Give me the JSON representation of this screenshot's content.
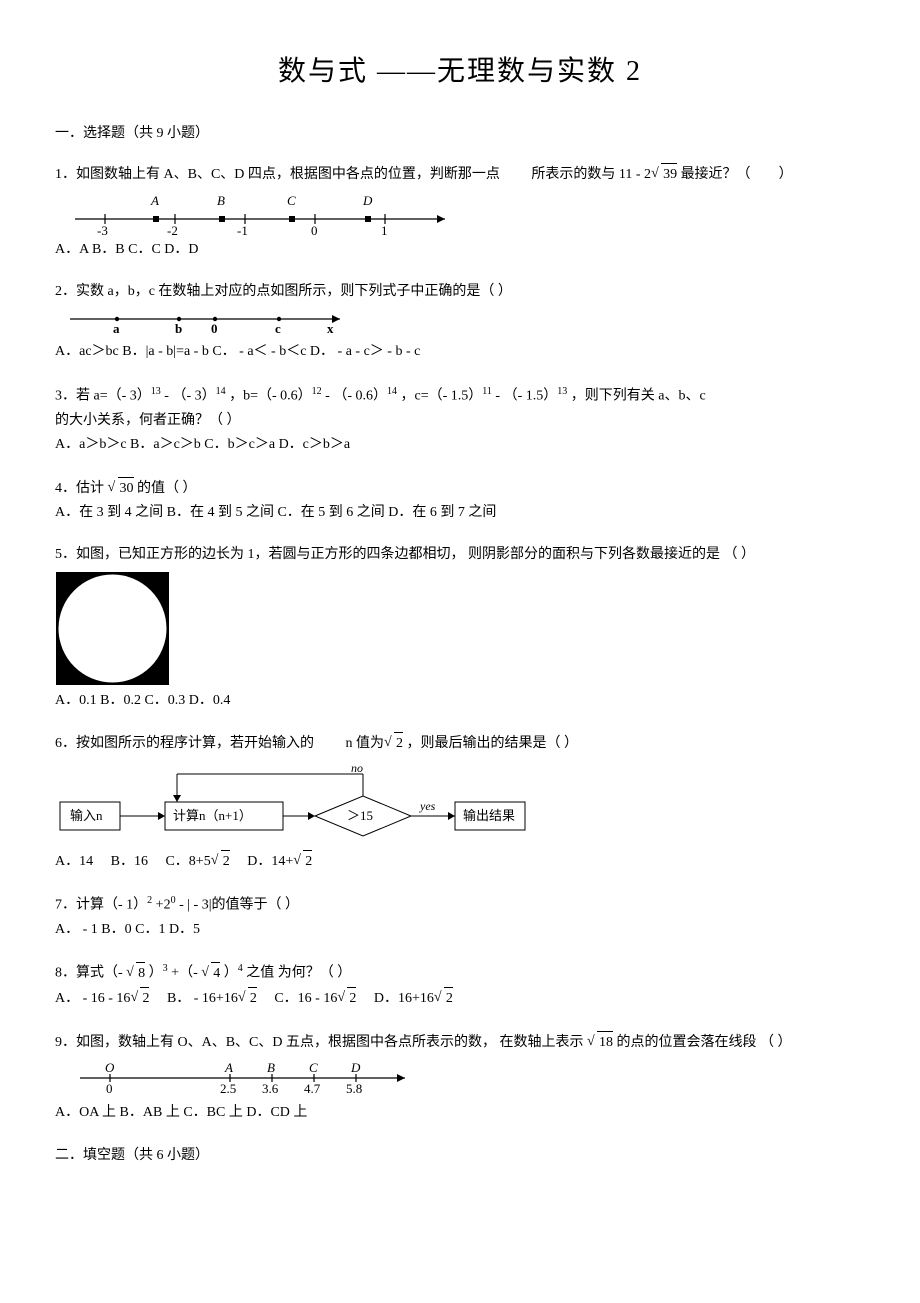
{
  "title": "数与式 ——无理数与实数  2",
  "section1": "一．选择题（共  9 小题）",
  "q1": {
    "stem_a": "1．如图数轴上有  A、B、C、D 四点，根据图中各点的位置，判断那一点",
    "stem_b": "所表示的数与  11 - 2",
    "stem_c": "最接近？（",
    "stem_d": "）",
    "sqrt": "39",
    "opt": "A．A    B．B    C．C    D．D"
  },
  "q2": {
    "stem": "2．实数  a，b，c 在数轴上对应的点如图所示，则下列式子中正确的是（            ）",
    "opt": "A．ac＞bc    B．|a - b|=a - b    C． - a＜ - b＜c   D． - a - c＞ - b - c"
  },
  "q3": {
    "stem_a": "3．若  a=（- 3）",
    "stem_b": " - （- 3）",
    "stem_c": "，b=（- 0.6）",
    "stem_d": " - （- 0.6）",
    "stem_e": "，c=（- 1.5）",
    "stem_f": " - （- 1.5）",
    "stem_g": "，则下列有关   a、b、c",
    "e1": "13",
    "e2": "14",
    "e3": "12",
    "e4": "14",
    "e5": "11",
    "e6": "13",
    "line2": "的大小关系，何者正确？（          ）",
    "opt": "A．a＞b＞c   B．a＞c＞b   C．b＞c＞a    D．c＞b＞a"
  },
  "q4": {
    "stem_a": "4．估计 ",
    "sqrt": "30",
    "stem_b": "的值（        ）",
    "opt": "A．在  3 到 4 之间  B．在  4 到 5 之间  C．在  5 到 6 之间  D．在  6 到 7 之间"
  },
  "q5": {
    "stem": "5．如图，已知正方形的边长为    1，若圆与正方形的四条边都相切，     则阴影部分的面积与下列各数最接近的是     （      ）",
    "opt": "A．0.1   B．0.2   C．0.3   D．0.4"
  },
  "q6": {
    "stem_a": "6．按如图所示的程序计算，若开始输入的",
    "stem_b": " n 值为",
    "sqrt": "2",
    "stem_c": "，则最后输出的结果是（         ）",
    "optA": "A．14",
    "optB": "B．16",
    "optC_a": "C．8+5",
    "optD_a": "D．14+",
    "sqrtOpt": "2",
    "flow_in": "输入n",
    "flow_calc": "计算n（n+1）",
    "flow_cond": "＞15",
    "flow_no": "no",
    "flow_yes": "yes",
    "flow_out": "输出结果"
  },
  "q7": {
    "stem_a": "7．计算（-   1）",
    "e1": "2",
    "stem_b": "+2",
    "e2": "0",
    "stem_c": " - | - 3|的值等于（        ）",
    "opt": "A． - 1  B．0     C．1    D．5"
  },
  "q8": {
    "stem_a": "8．算式（- ",
    "sqrt1": "8",
    "stem_b": "）",
    "e1": "3",
    "stem_c": "+（- ",
    "sqrt2": "4",
    "stem_d": "）",
    "e2": "4",
    "stem_e": " 之值 为何？（        ）",
    "optA_a": "A． - 16 - 16",
    "optB_a": "B． - 16+16",
    "optC_a": "C．16 - 16",
    "optD_a": "D．16+16",
    "sqrtOpt": "2"
  },
  "q9": {
    "stem_a": "9．如图，数轴上有   O、A、B、C、D 五点，根据图中各点所表示的数，    在数轴上表示 ",
    "sqrt": "18",
    "stem_b": "的点的位置会落在线段    （       ）",
    "opt": "A．OA 上     B．AB  上      C．BC 上     D．CD 上"
  },
  "section2": "二．填空题（共   6 小题）"
}
